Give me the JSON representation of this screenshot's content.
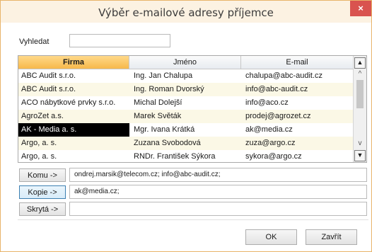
{
  "window": {
    "title": "Výběr e-mailové adresy příjemce",
    "close_label": "×"
  },
  "search": {
    "label": "Vyhledat",
    "value": ""
  },
  "grid": {
    "columns": [
      "Firma",
      "Jméno",
      "E-mail"
    ],
    "active_column": "Firma",
    "rows": [
      {
        "firma": "ABC Audit s.r.o.",
        "jmeno": "Ing. Jan Chalupa",
        "email": "chalupa@abc-audit.cz"
      },
      {
        "firma": "ABC Audit s.r.o.",
        "jmeno": "Ing. Roman Dvorský",
        "email": "info@abc-audit.cz"
      },
      {
        "firma": "ACO nábytkové prvky s.r.o.",
        "jmeno": "Michal Dolejší",
        "email": "info@aco.cz"
      },
      {
        "firma": "AgroZet a.s.",
        "jmeno": "Marek Světák",
        "email": "prodej@agrozet.cz"
      },
      {
        "firma": "AK - Media a. s.",
        "jmeno": "Mgr. Ivana Krátká",
        "email": "ak@media.cz"
      },
      {
        "firma": "Argo, a. s.",
        "jmeno": "Zuzana Svobodová",
        "email": "zuza@argo.cz"
      },
      {
        "firma": "Argo, a. s.",
        "jmeno": "RNDr. František Sýkora",
        "email": "sykora@argo.cz"
      }
    ],
    "selected_row": 4,
    "scrollbar": {
      "top_icon": "arrow-to-top-icon",
      "up_icon": "chevron-up-icon",
      "down_icon": "chevron-down-icon",
      "bottom_icon": "arrow-to-bottom-icon"
    }
  },
  "recipients": {
    "komu": {
      "button": "Komu ->",
      "value": "ondrej.marsik@telecom.cz; info@abc-audit.cz;"
    },
    "kopie": {
      "button": "Kopie ->",
      "value": "ak@media.cz;"
    },
    "skryta": {
      "button": "Skrytá ->",
      "value": ""
    }
  },
  "buttons": {
    "ok": "OK",
    "close": "Zavřít"
  },
  "colors": {
    "accent": "#f7b84a",
    "selected_bg": "#000000",
    "alt_row": "#fbf8e6",
    "title_bg": "#fcf2e2",
    "close_red": "#d9534f"
  }
}
